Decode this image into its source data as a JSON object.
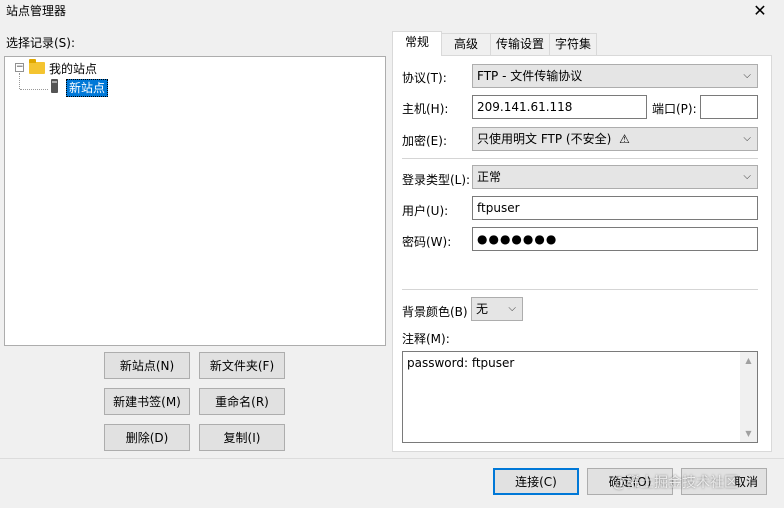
{
  "window": {
    "title": "站点管理器",
    "close": "✕"
  },
  "left": {
    "select_label": "选择记录(S):",
    "tree": {
      "root": "我的站点",
      "site": "新站点",
      "expander": "−"
    },
    "buttons": {
      "new_site": "新站点(N)",
      "new_folder": "新文件夹(F)",
      "new_bookmark": "新建书签(M)",
      "rename": "重命名(R)",
      "delete": "删除(D)",
      "copy": "复制(I)"
    }
  },
  "tabs": [
    {
      "label": "常规",
      "active": true
    },
    {
      "label": "高级"
    },
    {
      "label": "传输设置"
    },
    {
      "label": "字符集"
    }
  ],
  "general": {
    "protocol_label": "协议(T):",
    "protocol_value": "FTP - 文件传输协议",
    "host_label": "主机(H):",
    "host_value": "209.141.61.118",
    "port_label": "端口(P):",
    "port_value": "",
    "encryption_label": "加密(E):",
    "encryption_value": "只使用明文 FTP (不安全)",
    "warning_icon": "⚠",
    "logon_label": "登录类型(L):",
    "logon_value": "正常",
    "user_label": "用户(U):",
    "user_value": "ftpuser",
    "password_label": "密码(W):",
    "password_value": "●●●●●●●",
    "bgcolor_label": "背景颜色(B)",
    "bgcolor_value": "无",
    "comments_label": "注释(M):",
    "comments_value": "password: ftpuser"
  },
  "footer": {
    "connect": "连接(C)",
    "ok": "确定(O)",
    "cancel": "取消",
    "watermark": "@稀土掘金技术社区"
  },
  "icons": {
    "chevron": "⌵",
    "scroll_up": "▲",
    "scroll_down": "▼"
  }
}
